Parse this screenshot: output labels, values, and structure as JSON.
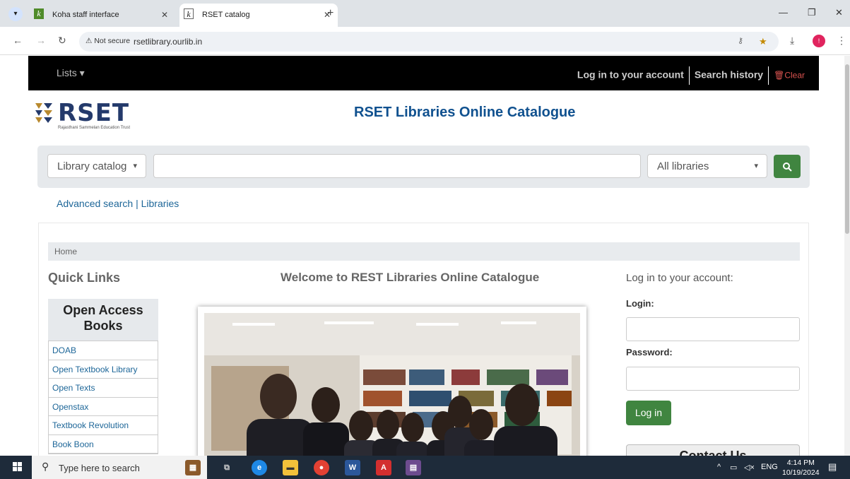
{
  "browser": {
    "tabs": [
      {
        "label": "Koha staff interface",
        "active": false
      },
      {
        "label": "RSET catalog",
        "active": true
      }
    ],
    "not_secure_label": "Not secure",
    "url": "rsetlibrary.ourlib.in"
  },
  "topnav": {
    "lists_label": "Lists",
    "login_link": "Log in to your account",
    "history_link": "Search history",
    "clear_link": "Clear"
  },
  "header": {
    "logo_text": "RSET",
    "logo_subtext": "Rajasthani Sammelan Education Trust",
    "site_title": "RSET Libraries Online Catalogue"
  },
  "search": {
    "index_select": "Library catalog",
    "query_value": "",
    "branch_select": "All libraries"
  },
  "more_search": {
    "advanced": "Advanced search",
    "separator": "|",
    "libraries": "Libraries"
  },
  "breadcrumb": {
    "home": "Home"
  },
  "quick_links": {
    "title": "Quick Links",
    "box_title": "Open Access Books",
    "items": [
      "DOAB",
      "Open Textbook Library",
      "Open Texts",
      "Openstax",
      "Textbook Revolution",
      "Book Boon"
    ]
  },
  "welcome": {
    "title": "Welcome to REST Libraries Online Catalogue"
  },
  "login": {
    "title": "Log in to your account:",
    "login_label": "Login:",
    "password_label": "Password:",
    "button": "Log in",
    "contact_title": "Contact Us"
  },
  "taskbar": {
    "search_placeholder": "Type here to search",
    "language": "ENG",
    "time": "4:14 PM",
    "date": "10/19/2024"
  },
  "colors": {
    "go_button": "#408540",
    "site_title": "#10518f",
    "link": "#1d6698",
    "topnav_bg": "#000000"
  }
}
